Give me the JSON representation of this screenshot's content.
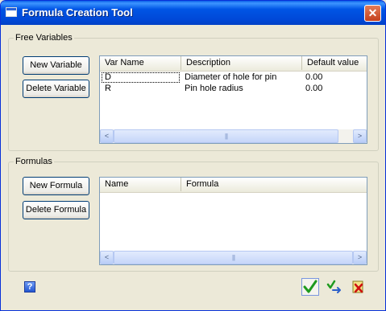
{
  "window": {
    "title": "Formula Creation Tool",
    "close_glyph": "✕"
  },
  "free_variables": {
    "legend": "Free Variables",
    "new_button": "New Variable",
    "delete_button": "Delete Variable",
    "columns": [
      "Var Name",
      "Description",
      "Default value"
    ],
    "rows": [
      {
        "name": "D",
        "description": "Diameter of hole for pin",
        "default": "0.00"
      },
      {
        "name": "R",
        "description": "Pin hole radius",
        "default": "0.00"
      }
    ]
  },
  "formulas": {
    "legend": "Formulas",
    "new_button": "New Formula",
    "delete_button": "Delete Formula",
    "columns": [
      "Name",
      "Formula"
    ],
    "rows": []
  },
  "scrollbar": {
    "left_arrow": "<",
    "right_arrow": ">",
    "grip": "|||"
  },
  "footer": {
    "help_glyph": "?"
  },
  "icons": [
    "help-icon",
    "checkmark-icon",
    "apply-arrow-icon",
    "cancel-icon"
  ],
  "colors": {
    "titlebar": "#0055e5",
    "dialog_bg": "#ece9d8",
    "ok_check": "#1e9a1e",
    "cancel_x": "#d01010"
  }
}
